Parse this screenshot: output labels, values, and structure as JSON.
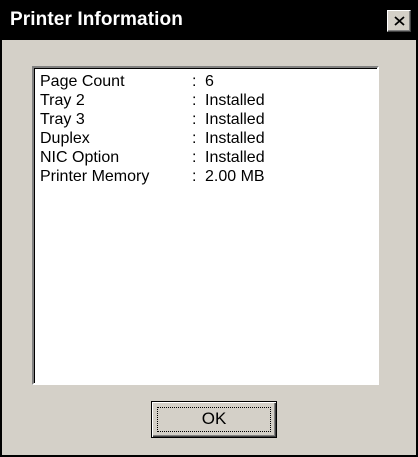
{
  "dialog": {
    "title": "Printer Information",
    "close_icon": "close-icon",
    "rows": [
      {
        "label": "Page Count",
        "separator": ":",
        "value": "6"
      },
      {
        "label": "Tray 2",
        "separator": ":",
        "value": "Installed"
      },
      {
        "label": "Tray 3",
        "separator": ":",
        "value": "Installed"
      },
      {
        "label": "Duplex",
        "separator": ":",
        "value": "Installed"
      },
      {
        "label": "NIC Option",
        "separator": ":",
        "value": "Installed"
      },
      {
        "label": "Printer Memory",
        "separator": ":",
        "value": "2.00 MB"
      }
    ],
    "ok_label": "OK"
  }
}
